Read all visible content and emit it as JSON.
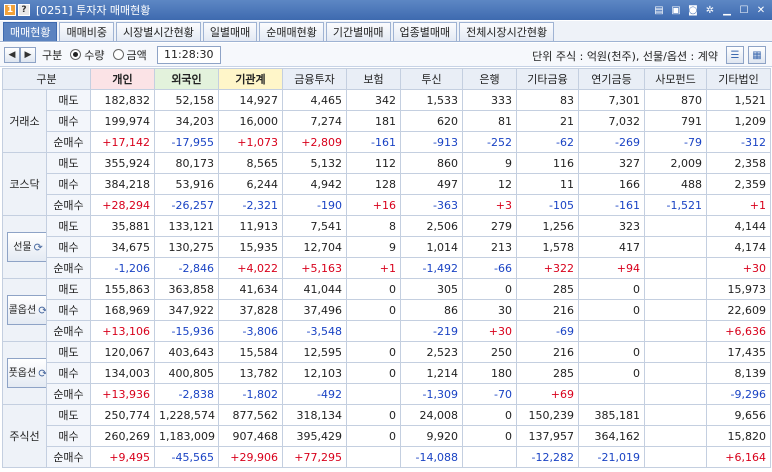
{
  "title_bar": {
    "badge1": "1",
    "badge2": "?",
    "title": "[0251] 투자자 매매현황"
  },
  "tabs": [
    "매매현황",
    "매매비중",
    "시장별시간현황",
    "일별매매",
    "순매매현황",
    "기간별매매",
    "업종별매매",
    "전체시장시간현황"
  ],
  "controls": {
    "gubun_label": "구분",
    "radio_qty": "수량",
    "radio_amt": "금액",
    "time": "11:28:30",
    "unit_text": "단위 주식 : 억원(천주), 선물/옵션 : 계약"
  },
  "table": {
    "headers": [
      "구분",
      "",
      "개인",
      "외국인",
      "기관계",
      "금융투자",
      "보험",
      "투신",
      "은행",
      "기타금융",
      "연기금등",
      "사모펀드",
      "기타법인"
    ],
    "row_labels": [
      "매도",
      "매수",
      "순매수"
    ],
    "markets": [
      {
        "name": "거래소",
        "button": false,
        "rows": [
          [
            "182,832",
            "52,158",
            "14,927",
            "4,465",
            "342",
            "1,533",
            "333",
            "83",
            "7,301",
            "870",
            "1,521"
          ],
          [
            "199,974",
            "34,203",
            "16,000",
            "7,274",
            "181",
            "620",
            "81",
            "21",
            "7,032",
            "791",
            "1,209"
          ],
          [
            "+17,142",
            "-17,955",
            "+1,073",
            "+2,809",
            "-161",
            "-913",
            "-252",
            "-62",
            "-269",
            "-79",
            "-312"
          ]
        ]
      },
      {
        "name": "코스닥",
        "button": false,
        "rows": [
          [
            "355,924",
            "80,173",
            "8,565",
            "5,132",
            "112",
            "860",
            "9",
            "116",
            "327",
            "2,009",
            "2,358"
          ],
          [
            "384,218",
            "53,916",
            "6,244",
            "4,942",
            "128",
            "497",
            "12",
            "11",
            "166",
            "488",
            "2,359"
          ],
          [
            "+28,294",
            "-26,257",
            "-2,321",
            "-190",
            "+16",
            "-363",
            "+3",
            "-105",
            "-161",
            "-1,521",
            "+1"
          ]
        ]
      },
      {
        "name": "선물",
        "button": true,
        "rows": [
          [
            "35,881",
            "133,121",
            "11,913",
            "7,541",
            "8",
            "2,506",
            "279",
            "1,256",
            "323",
            "",
            "4,144"
          ],
          [
            "34,675",
            "130,275",
            "15,935",
            "12,704",
            "9",
            "1,014",
            "213",
            "1,578",
            "417",
            "",
            "4,174"
          ],
          [
            "-1,206",
            "-2,846",
            "+4,022",
            "+5,163",
            "+1",
            "-1,492",
            "-66",
            "+322",
            "+94",
            "",
            "+30"
          ]
        ]
      },
      {
        "name": "콜옵션",
        "button": true,
        "rows": [
          [
            "155,863",
            "363,858",
            "41,634",
            "41,044",
            "0",
            "305",
            "0",
            "285",
            "0",
            "",
            "15,973"
          ],
          [
            "168,969",
            "347,922",
            "37,828",
            "37,496",
            "0",
            "86",
            "30",
            "216",
            "0",
            "",
            "22,609"
          ],
          [
            "+13,106",
            "-15,936",
            "-3,806",
            "-3,548",
            "",
            "-219",
            "+30",
            "-69",
            "",
            "",
            "+6,636"
          ]
        ]
      },
      {
        "name": "풋옵션",
        "button": true,
        "rows": [
          [
            "120,067",
            "403,643",
            "15,584",
            "12,595",
            "0",
            "2,523",
            "250",
            "216",
            "0",
            "",
            "17,435"
          ],
          [
            "134,003",
            "400,805",
            "13,782",
            "12,103",
            "0",
            "1,214",
            "180",
            "285",
            "0",
            "",
            "8,139"
          ],
          [
            "+13,936",
            "-2,838",
            "-1,802",
            "-492",
            "",
            "-1,309",
            "-70",
            "+69",
            "",
            "",
            "-9,296"
          ]
        ]
      },
      {
        "name": "주식선",
        "button": false,
        "rows": [
          [
            "250,774",
            "1,228,574",
            "877,562",
            "318,134",
            "0",
            "24,008",
            "0",
            "150,239",
            "385,181",
            "",
            "9,656"
          ],
          [
            "260,269",
            "1,183,009",
            "907,468",
            "395,429",
            "0",
            "9,920",
            "0",
            "137,957",
            "364,162",
            "",
            "15,820"
          ],
          [
            "+9,495",
            "-45,565",
            "+29,906",
            "+77,295",
            "",
            "-14,088",
            "",
            "-12,282",
            "-21,019",
            "",
            "+6,164"
          ]
        ]
      }
    ]
  },
  "colors": {
    "positive": "#d8001b",
    "negative": "#1a43c4",
    "accent": "#3e6aaf"
  }
}
